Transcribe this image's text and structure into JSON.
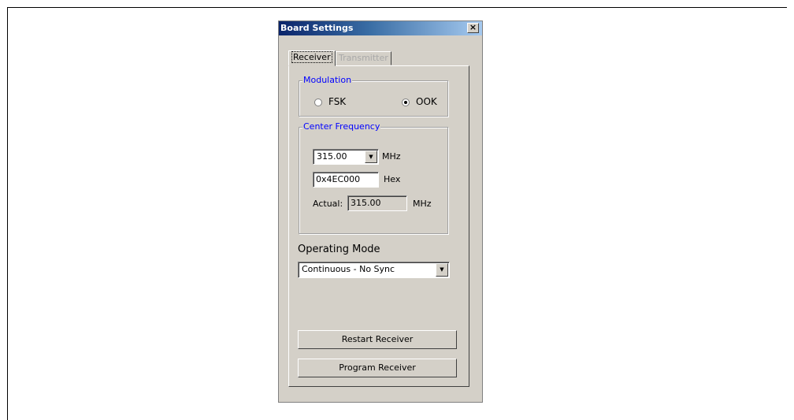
{
  "window": {
    "title": "Board Settings",
    "close_label": "×"
  },
  "tabs": [
    {
      "label": "Receiver",
      "active": true
    },
    {
      "label": "Transmitter",
      "active": false
    }
  ],
  "modulation": {
    "label": "Modulation",
    "options": [
      {
        "label": "FSK",
        "selected": false
      },
      {
        "label": "OOK",
        "selected": true
      }
    ]
  },
  "center_frequency": {
    "label": "Center Frequency",
    "frequency_value": "315.00",
    "frequency_unit": "MHz",
    "hex_value": "0x4EC000",
    "hex_label": "Hex",
    "actual_label": "Actual:",
    "actual_value": "315.00",
    "actual_unit": "MHz"
  },
  "operating_mode": {
    "label": "Operating Mode",
    "selected": "Continuous - No Sync"
  },
  "buttons": {
    "restart": "Restart Receiver",
    "program": "Program Receiver"
  },
  "icons": {
    "dropdown": "chevron-down-icon",
    "close": "close-icon"
  },
  "colors": {
    "group_label": "#0000ff",
    "title_gradient_start": "#0a246a",
    "title_gradient_end": "#a6caf0",
    "dialog_face": "#d4d0c8"
  }
}
